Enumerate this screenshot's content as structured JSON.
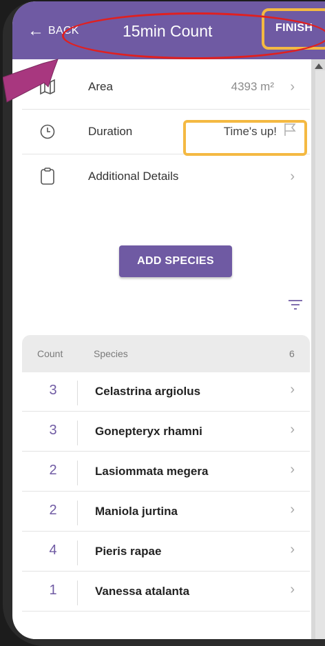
{
  "header": {
    "back_label": "BACK",
    "title": "15min Count",
    "finish_label": "FINISH"
  },
  "details": [
    {
      "icon": "map-icon",
      "label": "Area",
      "value": "4393 m²",
      "chevron": "›"
    },
    {
      "icon": "clock-icon",
      "label": "Duration",
      "value": "Time's up!",
      "chevron": ""
    },
    {
      "icon": "clipboard-icon",
      "label": "Additional Details",
      "value": "",
      "chevron": "›"
    }
  ],
  "add_species_label": "ADD SPECIES",
  "species_list": {
    "count_header": "Count",
    "species_header": "Species",
    "total": "6",
    "rows": [
      {
        "count": "3",
        "name": "Celastrina argiolus"
      },
      {
        "count": "3",
        "name": "Gonepteryx rhamni"
      },
      {
        "count": "2",
        "name": "Lasiommata megera"
      },
      {
        "count": "2",
        "name": "Maniola jurtina"
      },
      {
        "count": "4",
        "name": "Pieris rapae"
      },
      {
        "count": "1",
        "name": "Vanessa atalanta"
      }
    ]
  },
  "colors": {
    "accent": "#6f5aa3",
    "highlight_box": "#f4b942",
    "highlight_oval": "#e02020",
    "pointer": "#a8377f"
  }
}
